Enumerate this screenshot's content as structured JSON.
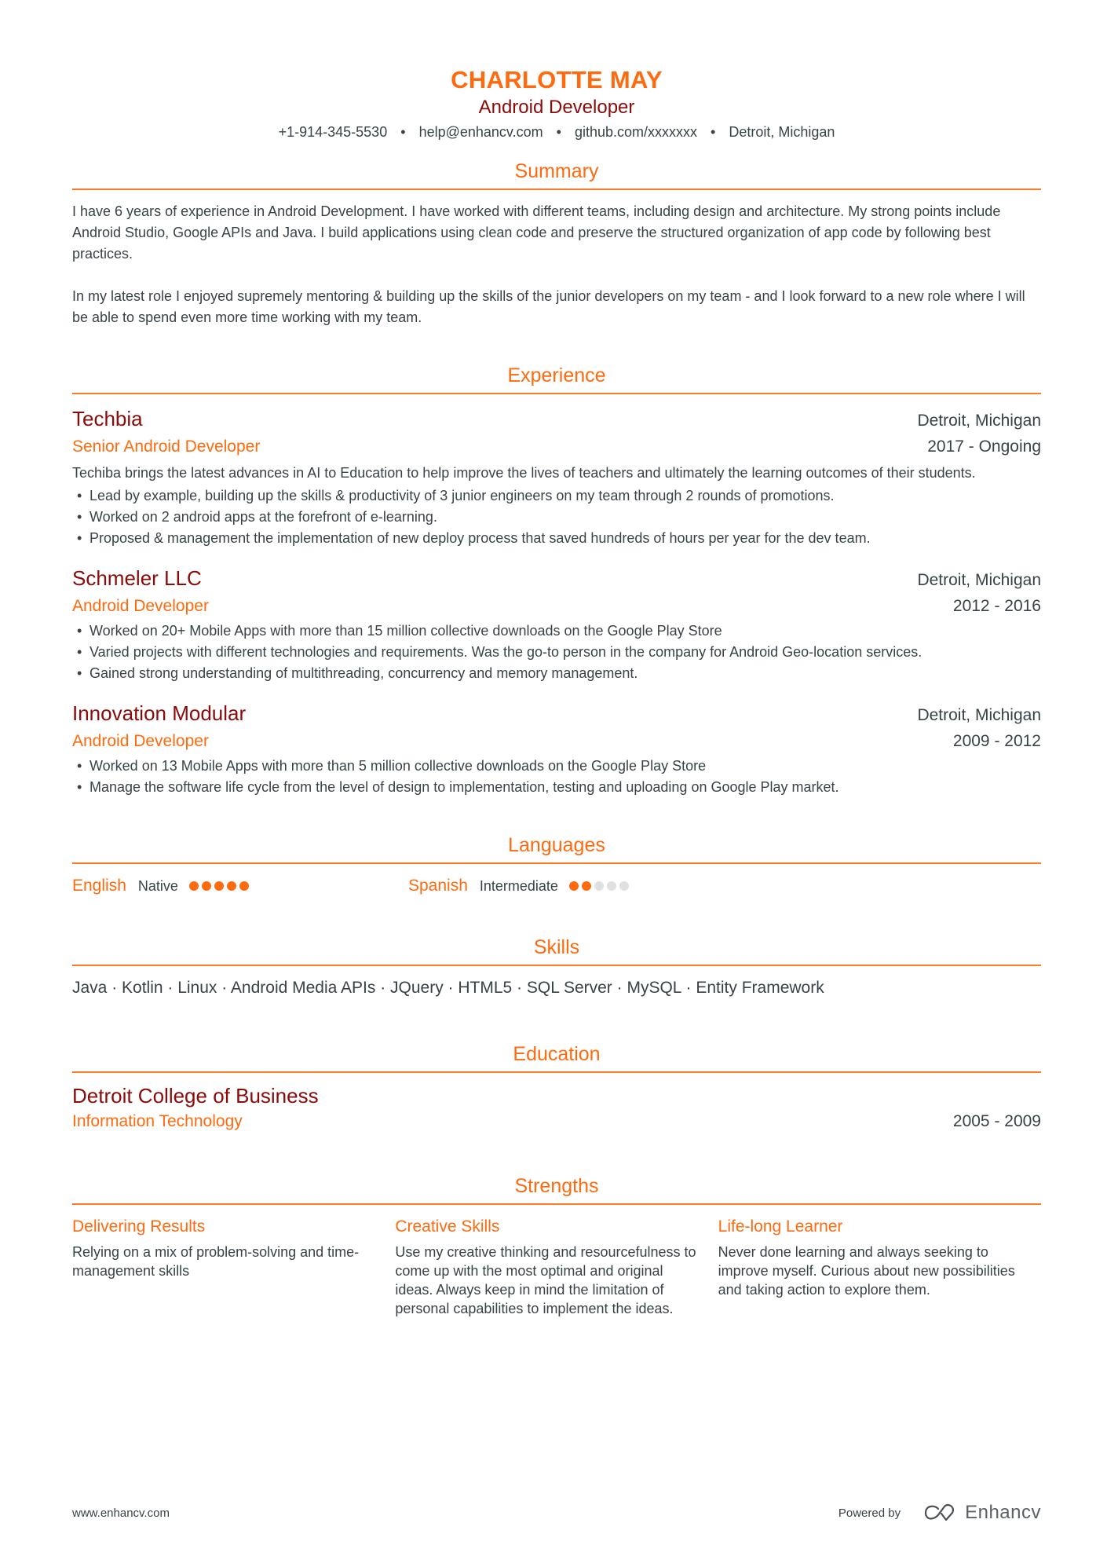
{
  "header": {
    "name": "CHARLOTTE MAY",
    "title": "Android Developer",
    "contacts": [
      "+1-914-345-5530",
      "help@enhancv.com",
      "github.com/xxxxxxx",
      "Detroit, Michigan"
    ],
    "separator": "•"
  },
  "colors": {
    "accent": "#ff6a0e",
    "dark_red": "#8b0a0a",
    "text": "#384347",
    "dot_off": "#e0e0e0"
  },
  "summary": {
    "heading": "Summary",
    "paragraphs": [
      "I have 6 years of experience in Android Development. I have worked with different teams, including design and architecture. My strong points include Android Studio, Google APIs and Java. I build applications using clean code and preserve the structured organization of app code by following best practices.",
      "In my latest role I enjoyed supremely mentoring & building up the skills of the junior developers on my team - and I look forward to a new role where I will be able to spend even more time working with my team."
    ]
  },
  "experience": {
    "heading": "Experience",
    "jobs": [
      {
        "company": "Techbia",
        "location": "Detroit, Michigan",
        "role": "Senior Android Developer",
        "dates": "2017 - Ongoing",
        "description": "Techiba brings the latest advances in AI to Education to help improve the lives of teachers and ultimately the learning outcomes of their students.",
        "bullets": [
          "Lead by example, building up the skills & productivity of 3 junior engineers on my team through 2 rounds of promotions.",
          "Worked on 2 android apps at the forefront of e-learning.",
          "Proposed & management the implementation of new deploy process that saved hundreds of hours per year for the dev team."
        ]
      },
      {
        "company": "Schmeler LLC",
        "location": "Detroit, Michigan",
        "role": "Android Developer",
        "dates": "2012 - 2016",
        "description": "",
        "bullets": [
          "Worked on 20+ Mobile Apps with more than 15 million collective downloads on the Google Play Store",
          "Varied projects with different technologies and requirements. Was the go-to person in the company for Android Geo-location services.",
          "Gained strong understanding of multithreading, concurrency and memory management."
        ]
      },
      {
        "company": "Innovation Modular",
        "location": "Detroit, Michigan",
        "role": "Android Developer",
        "dates": "2009 - 2012",
        "description": "",
        "bullets": [
          "Worked on 13 Mobile Apps with more than 5 million collective downloads on the Google Play Store",
          "Manage the software life cycle from the level of design to implementation, testing and uploading on Google Play market."
        ]
      }
    ]
  },
  "languages": {
    "heading": "Languages",
    "items": [
      {
        "name": "English",
        "level": "Native",
        "rating": 5,
        "max": 5
      },
      {
        "name": "Spanish",
        "level": "Intermediate",
        "rating": 2,
        "max": 5
      }
    ]
  },
  "skills": {
    "heading": "Skills",
    "line": "Java · Kotlin · Linux ·  Android Media APIs · JQuery · HTML5 · SQL Server · MySQL · Entity Framework"
  },
  "education": {
    "heading": "Education",
    "items": [
      {
        "school": "Detroit College of Business",
        "degree": "Information Technology",
        "dates": "2005 - 2009"
      }
    ]
  },
  "strengths": {
    "heading": "Strengths",
    "items": [
      {
        "title": "Delivering Results",
        "description": "Relying on a mix of problem-solving and time-management skills"
      },
      {
        "title": "Creative Skills",
        "description": "Use my creative thinking and resourcefulness to come up with the most optimal and original ideas. Always keep in mind the limitation of personal capabilities to implement the ideas."
      },
      {
        "title": "Life-long Learner",
        "description": "Never done learning and always seeking to improve myself. Curious about new possibilities and taking action to explore them."
      }
    ]
  },
  "footer": {
    "url": "www.enhancv.com",
    "powered_by": "Powered by",
    "brand": "Enhancv",
    "brand_icon": "enhancv-logo-icon"
  }
}
